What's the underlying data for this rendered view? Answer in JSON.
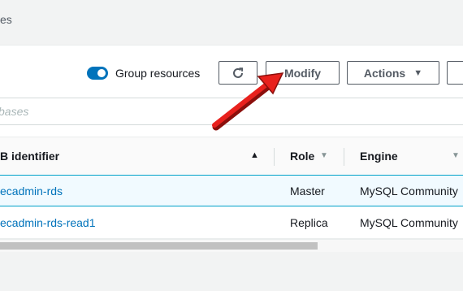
{
  "breadcrumb": {
    "fragment": "es"
  },
  "toolbar": {
    "group_resources_label": "Group resources",
    "group_resources_on": true,
    "refresh_icon": "refresh-icon",
    "modify_label": "Modify",
    "actions_label": "Actions",
    "actions_caret": "▼"
  },
  "search": {
    "placeholder": "bases"
  },
  "table": {
    "columns": [
      {
        "label": "B identifier",
        "sort": "▲"
      },
      {
        "label": "Role",
        "sort": "▼"
      },
      {
        "label": "Engine",
        "sort": "▼"
      }
    ],
    "rows": [
      {
        "identifier": "ecadmin-rds",
        "role": "Master",
        "engine": "MySQL Community"
      },
      {
        "identifier": "ecadmin-rds-read1",
        "role": "Replica",
        "engine": "MySQL Community"
      }
    ]
  },
  "annotation": {
    "type": "red-arrow",
    "points_to": "modify-button"
  },
  "colors": {
    "accent": "#0073bb",
    "arrow": "#e8211d"
  }
}
